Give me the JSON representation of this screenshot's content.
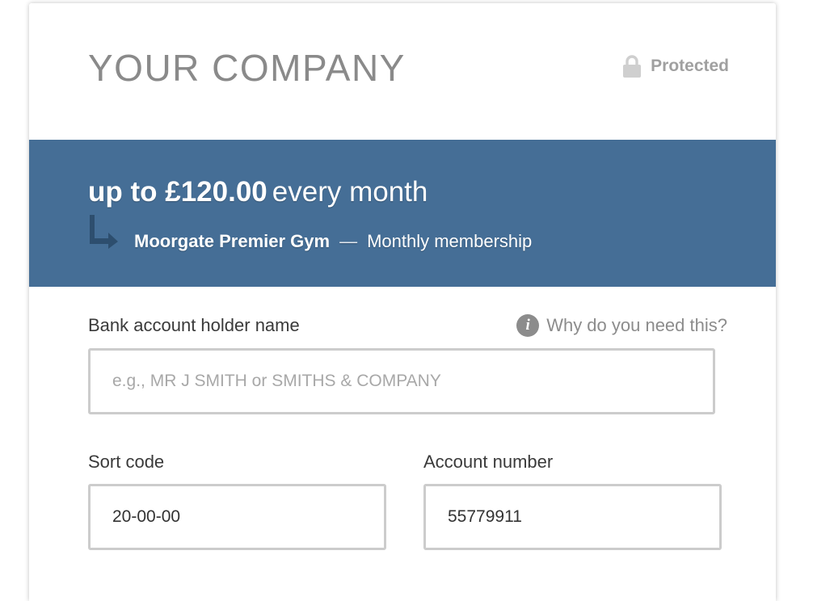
{
  "header": {
    "company_name": "YOUR COMPANY",
    "security_label": "Protected",
    "security_icon": "lock-icon"
  },
  "plan": {
    "amount": "up to £120.00",
    "frequency": "every month",
    "merchant": "Moorgate Premier Gym",
    "separator": "—",
    "description": "Monthly membership",
    "band_color": "#456e96"
  },
  "form": {
    "holder_label": "Bank account holder name",
    "help_link": "Why do you need this?",
    "holder_placeholder": "e.g., MR J SMITH or SMITHS & COMPANY",
    "holder_value": "",
    "sort_code_label": "Sort code",
    "sort_code_value": "20-00-00",
    "account_number_label": "Account number",
    "account_number_value": "55779911"
  }
}
